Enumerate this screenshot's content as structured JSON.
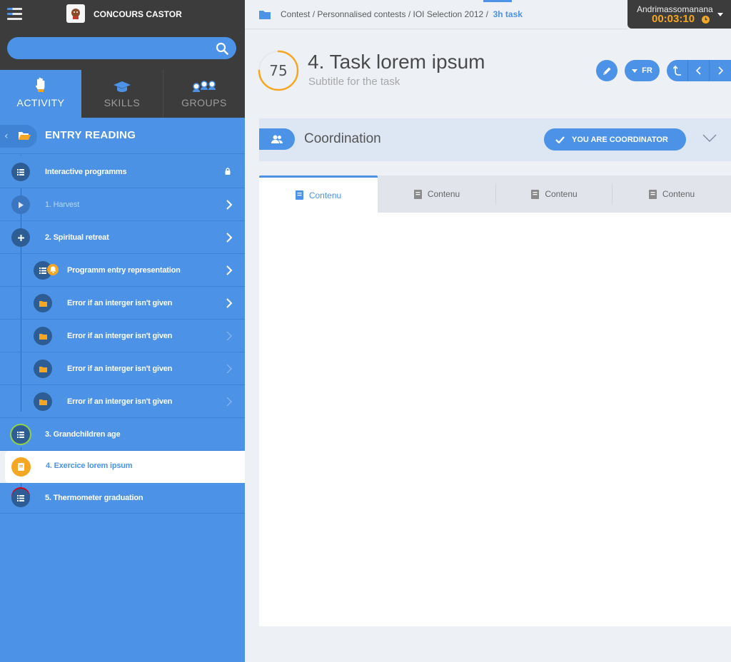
{
  "app": {
    "title": "CONCOURS CASTOR"
  },
  "search": {
    "placeholder": "",
    "value": ""
  },
  "sidebar_tabs": [
    {
      "label": "ACTIVITY",
      "icon": "hand-icon",
      "active": true
    },
    {
      "label": "SKILLS",
      "icon": "graduation-cap-icon",
      "active": false
    },
    {
      "label": "GROUPS",
      "icon": "group-icon",
      "active": false
    }
  ],
  "entry": {
    "title": "ENTRY READING"
  },
  "tree": [
    {
      "label": "Interactive programms",
      "icon": "list-icon",
      "right": "lock-icon"
    },
    {
      "label": "1. Harvest",
      "icon": "play-icon",
      "right": "chevron-right-icon"
    },
    {
      "label": "2. Spiritual retreat",
      "icon": "plus-icon",
      "right": "chevron-right-icon"
    },
    {
      "label": "Programm entry representation",
      "icon": "list-icon",
      "right": "chevron-right-icon",
      "badge": "bell-icon"
    },
    {
      "label": "Error if an interger isn't given",
      "icon": "folder-icon",
      "right": "chevron-right-icon"
    },
    {
      "label": "Error if an interger isn't given",
      "icon": "folder-icon",
      "right": "chevron-right-icon"
    },
    {
      "label": "Error if an interger isn't given",
      "icon": "folder-icon",
      "right": "chevron-right-icon"
    },
    {
      "label": "Error if an interger isn't given",
      "icon": "folder-icon",
      "right": "chevron-right-icon"
    },
    {
      "label": "3. Grandchildren age",
      "icon": "list-icon"
    },
    {
      "label": "4. Exercice lorem ipsum",
      "icon": "book-icon",
      "selected": true
    },
    {
      "label": "5. Thermometer graduation",
      "icon": "list-icon"
    }
  ],
  "breadcrumb": {
    "items": [
      "Contest",
      "Personnalised contests",
      "IOI Selection 2012"
    ],
    "separator": "/",
    "current": "3h task"
  },
  "user": {
    "name": "Andrimassomanana",
    "timer": "00:03:10"
  },
  "task": {
    "score": "75",
    "title": "4. Task lorem ipsum",
    "subtitle": "Subtitle for the task",
    "score_fraction": 0.75
  },
  "toolbar": {
    "lang": "FR"
  },
  "coordination": {
    "title": "Coordination",
    "button": "YOU ARE COORDINATOR"
  },
  "content_tabs": [
    {
      "label": "Contenu",
      "active": true
    },
    {
      "label": "Contenu",
      "active": false
    },
    {
      "label": "Contenu",
      "active": false
    },
    {
      "label": "Contenu",
      "active": false
    }
  ],
  "colors": {
    "accent": "#4c92e6",
    "dark": "#3c3c3c",
    "orange": "#f5a623",
    "green": "#7ed321"
  }
}
